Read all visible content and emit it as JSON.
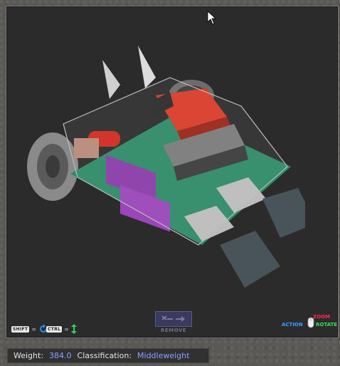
{
  "controls": {
    "shift_key": "SHIFT",
    "ctrl_key": "CTRL",
    "equals": "="
  },
  "toolbar": {
    "remove_label": "REMOVE"
  },
  "mouse_legend": {
    "zoom": "ZOOM",
    "action": "ACTION",
    "rotate": "ROTATE"
  },
  "status": {
    "weight_label": "Weight:",
    "weight_value": "384.0",
    "classification_label": "Classification:",
    "classification_value": "Middleweight"
  },
  "colors": {
    "viewport_bg": "#2b2b2b",
    "value_text": "#8aa0ff",
    "zoom": "#ff2a55",
    "action": "#39a0ff",
    "rotate": "#35e05a"
  },
  "icons": [
    "cursor-arrow-icon",
    "rotate-icon",
    "vertical-move-icon",
    "remove-tool-icon",
    "mouse-icon"
  ]
}
